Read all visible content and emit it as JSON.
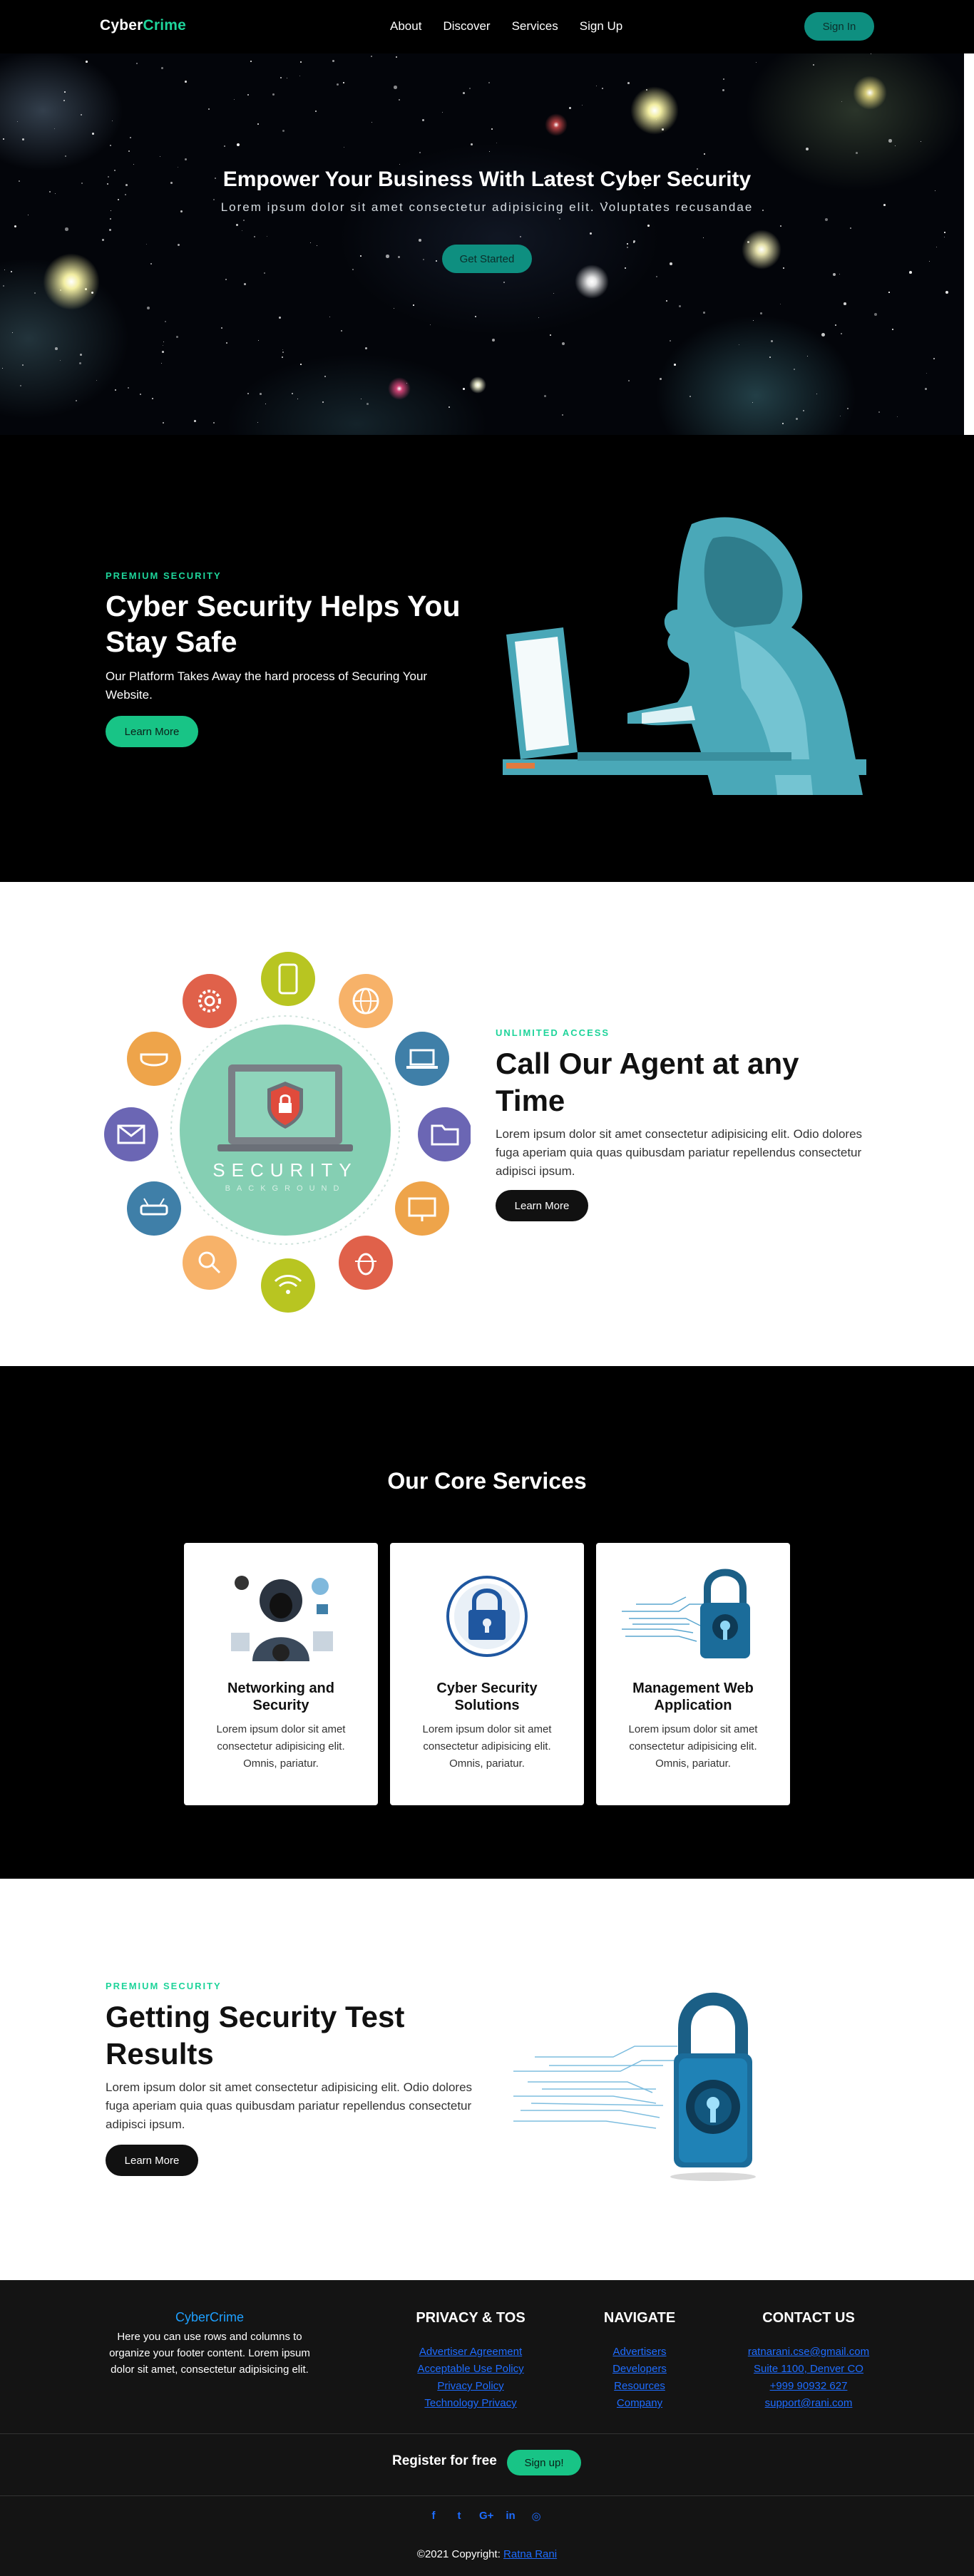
{
  "nav": {
    "brand_main": "Cyber",
    "brand_accent": "Crime",
    "links": [
      "About",
      "Discover",
      "Services",
      "Sign Up"
    ],
    "signin_label": "Sign In"
  },
  "hero": {
    "title": "Empower Your Business With Latest Cyber Security",
    "subtitle": "Lorem ipsum dolor sit amet consectetur adipisicing elit. Voluptates recusandae",
    "cta_label": "Get Started"
  },
  "premium": {
    "kicker": "PREMIUM SECURITY",
    "title": "Cyber Security Helps You Stay Safe",
    "text": "Our Platform Takes Away the hard process of Securing Your Website.",
    "button_label": "Learn More"
  },
  "agent": {
    "kicker": "UNLIMITED ACCESS",
    "title": "Call Our Agent at any Time",
    "text": "Lorem ipsum dolor sit amet consectetur adipisicing elit. Odio dolores fuga aperiam quia quas quibusdam pariatur repellendus consectetur adipisci ipsum.",
    "button_label": "Learn More",
    "badge_word": "SECURITY",
    "badge_sub": "BACKGROUND"
  },
  "services": {
    "title": "Our Core Services",
    "cards": [
      {
        "title": "Networking and Security",
        "text": "Lorem ipsum dolor sit amet consectetur adipisicing elit. Omnis, pariatur."
      },
      {
        "title": "Cyber Security Solutions",
        "text": "Lorem ipsum dolor sit amet consectetur adipisicing elit. Omnis, pariatur."
      },
      {
        "title": "Management Web Application",
        "text": "Lorem ipsum dolor sit amet consectetur adipisicing elit. Omnis, pariatur."
      }
    ]
  },
  "results": {
    "kicker": "PREMIUM SECURITY",
    "title": "Getting Security Test Results",
    "text": "Lorem ipsum dolor sit amet consectetur adipisicing elit. Odio dolores fuga aperiam quia quas quibusdam pariatur repellendus consectetur adipisci ipsum.",
    "button_label": "Learn More"
  },
  "footer": {
    "brand": "CyberCrime",
    "brand_text": "Here you can use rows and columns to organize your footer content. Lorem ipsum dolor sit amet, consectetur adipisicing elit.",
    "columns": [
      {
        "title": "PRIVACY & TOS",
        "links": [
          "Advertiser Agreement",
          "Acceptable Use Policy",
          "Privacy Policy",
          "Technology Privacy"
        ]
      },
      {
        "title": "NAVIGATE",
        "links": [
          "Advertisers",
          "Developers",
          "Resources",
          "Company"
        ]
      },
      {
        "title": "CONTACT US",
        "links": [
          "ratnarani.cse@gmail.com",
          "Suite 1100, Denver CO",
          "+999 90932 627",
          "support@rani.com"
        ]
      }
    ],
    "register_label": "Register for free",
    "signup_label": "Sign up!",
    "social_icons": [
      "facebook-icon",
      "twitter-icon",
      "google-plus-icon",
      "linkedin-icon",
      "instagram-icon"
    ],
    "social_glyphs": [
      "f",
      "t",
      "G+",
      "in",
      "◎"
    ],
    "copyright_prefix": "©2021 Copyright:",
    "copyright_name": "Ratna Rani"
  }
}
